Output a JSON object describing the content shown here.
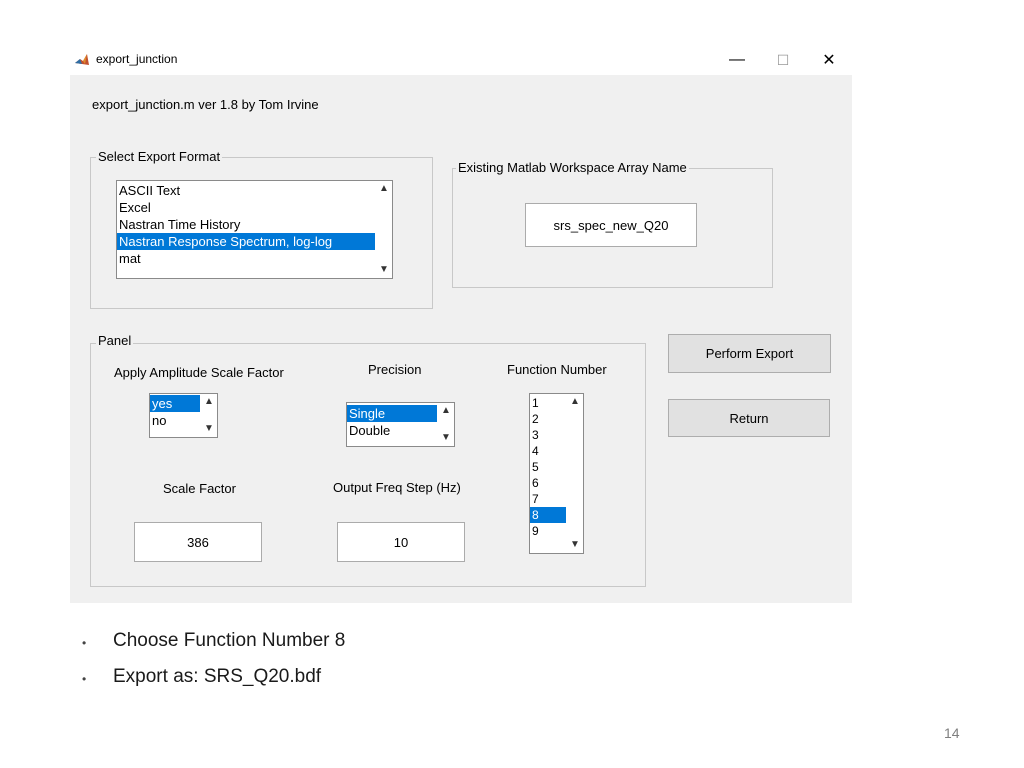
{
  "window": {
    "title": "export_junction",
    "minimize_glyph": "—",
    "maximize_glyph": "☐",
    "close_glyph": "✕"
  },
  "header_text": "export_junction.m  ver 1.8 by Tom Irvine",
  "export_format": {
    "legend": "Select Export Format",
    "items": [
      {
        "label": "ASCII Text",
        "selected": false
      },
      {
        "label": "Excel",
        "selected": false
      },
      {
        "label": "Nastran Time History",
        "selected": false
      },
      {
        "label": "Nastran Response Spectrum, log-log",
        "selected": true
      },
      {
        "label": "mat",
        "selected": false
      }
    ]
  },
  "workspace": {
    "legend": "Existing Matlab Workspace Array Name",
    "value": "srs_spec_new_Q20"
  },
  "panel": {
    "legend": "Panel",
    "amplitude": {
      "label": "Apply Amplitude Scale Factor",
      "items": [
        {
          "label": "yes",
          "selected": true
        },
        {
          "label": "no",
          "selected": false
        }
      ]
    },
    "precision": {
      "label": "Precision",
      "items": [
        {
          "label": "Single",
          "selected": true
        },
        {
          "label": "Double",
          "selected": false
        }
      ]
    },
    "function_number": {
      "label": "Function Number",
      "items": [
        {
          "label": "1",
          "selected": false
        },
        {
          "label": "2",
          "selected": false
        },
        {
          "label": "3",
          "selected": false
        },
        {
          "label": "4",
          "selected": false
        },
        {
          "label": "5",
          "selected": false
        },
        {
          "label": "6",
          "selected": false
        },
        {
          "label": "7",
          "selected": false
        },
        {
          "label": "8",
          "selected": true
        },
        {
          "label": "9",
          "selected": false
        }
      ]
    },
    "scale_factor": {
      "label": "Scale Factor",
      "value": "386"
    },
    "output_freq_step": {
      "label": "Output Freq Step (Hz)",
      "value": "10"
    }
  },
  "buttons": {
    "perform_export": "Perform Export",
    "return": "Return"
  },
  "bullets": {
    "dot": "•",
    "items": [
      "Choose Function Number 8",
      "Export as:  SRS_Q20.bdf"
    ]
  },
  "page_number": "14",
  "colors": {
    "selection": "#0078d7",
    "window_bg": "#f0f0f0"
  },
  "icons": {
    "app": "matlab-logo-icon",
    "scroll_up": "scroll-up-arrow-icon",
    "scroll_down": "scroll-down-arrow-icon"
  }
}
